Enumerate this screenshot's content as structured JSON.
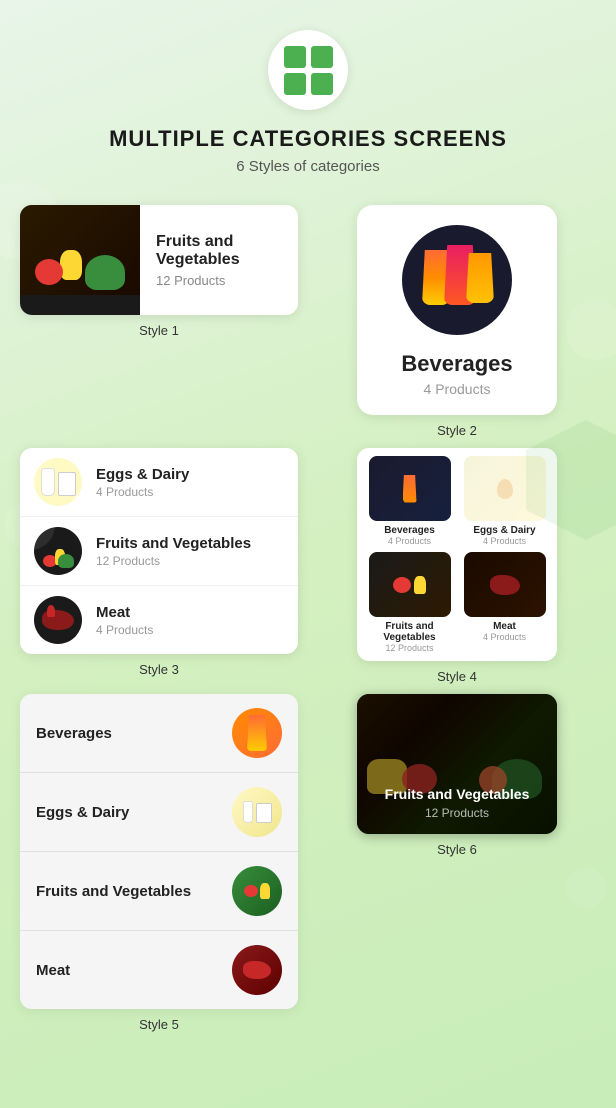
{
  "header": {
    "title": "MULTIPLE CATEGORIES SCREENS",
    "subtitle": "6 Styles of categories",
    "logo_icon": "grid-icon"
  },
  "styles": {
    "style1": {
      "label": "Style 1",
      "category": {
        "name": "Fruits and Vegetables",
        "count": "12 Products"
      }
    },
    "style2": {
      "label": "Style 2",
      "category": {
        "name": "Beverages",
        "count": "4 Products"
      }
    },
    "style3": {
      "label": "Style 3",
      "items": [
        {
          "name": "Eggs & Dairy",
          "count": "4 Products"
        },
        {
          "name": "Fruits and Vegetables",
          "count": "12 Products"
        },
        {
          "name": "Meat",
          "count": "4 Products"
        }
      ]
    },
    "style4": {
      "label": "Style 4",
      "items": [
        {
          "name": "Beverages",
          "count": "4 Products"
        },
        {
          "name": "Eggs & Dairy",
          "count": "4 Products"
        },
        {
          "name": "Fruits and Vegetables",
          "count": "12 Products"
        },
        {
          "name": "Meat",
          "count": "4 Products"
        }
      ]
    },
    "style5": {
      "label": "Style 5",
      "items": [
        {
          "name": "Beverages"
        },
        {
          "name": "Eggs & Dairy"
        },
        {
          "name": "Fruits and Vegetables"
        },
        {
          "name": "Meat"
        }
      ]
    },
    "style6": {
      "label": "Style 6",
      "category": {
        "name": "Fruits and Vegetables",
        "count": "12 Products"
      }
    }
  },
  "colors": {
    "green": "#4caf50",
    "dark": "#1a1a1a",
    "light_bg": "#e8f5e9"
  }
}
